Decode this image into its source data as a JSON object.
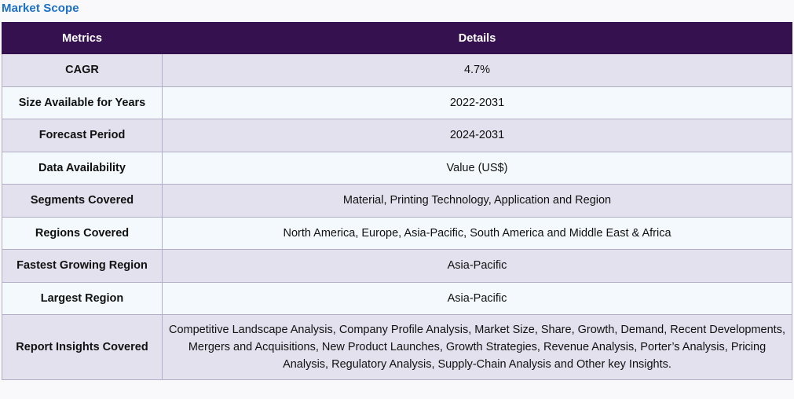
{
  "section": {
    "title": "Market Scope"
  },
  "table": {
    "headers": {
      "metric": "Metrics",
      "details": "Details"
    },
    "rows": [
      {
        "metric": "CAGR",
        "details": "4.7%"
      },
      {
        "metric": "Size Available for Years",
        "details": "2022-2031"
      },
      {
        "metric": "Forecast Period",
        "details": "2024-2031"
      },
      {
        "metric": "Data Availability",
        "details": "Value (US$)"
      },
      {
        "metric": "Segments Covered",
        "details": "Material, Printing Technology, Application and Region"
      },
      {
        "metric": "Regions Covered",
        "details": "North America, Europe, Asia-Pacific, South America and Middle East & Africa"
      },
      {
        "metric": "Fastest Growing Region",
        "details": "Asia-Pacific"
      },
      {
        "metric": "Largest Region",
        "details": "Asia-Pacific"
      },
      {
        "metric": "Report Insights Covered",
        "details": "Competitive Landscape Analysis, Company Profile Analysis, Market Size, Share, Growth, Demand, Recent Developments, Mergers and Acquisitions, New Product Launches, Growth Strategies, Revenue Analysis, Porter’s Analysis, Pricing Analysis, Regulatory Analysis, Supply-Chain Analysis and Other key Insights."
      }
    ]
  },
  "colors": {
    "header_bg": "#36114f",
    "title": "#1d6fc2",
    "row_odd": "#e4e1ee",
    "row_even": "#f3f9fc"
  }
}
